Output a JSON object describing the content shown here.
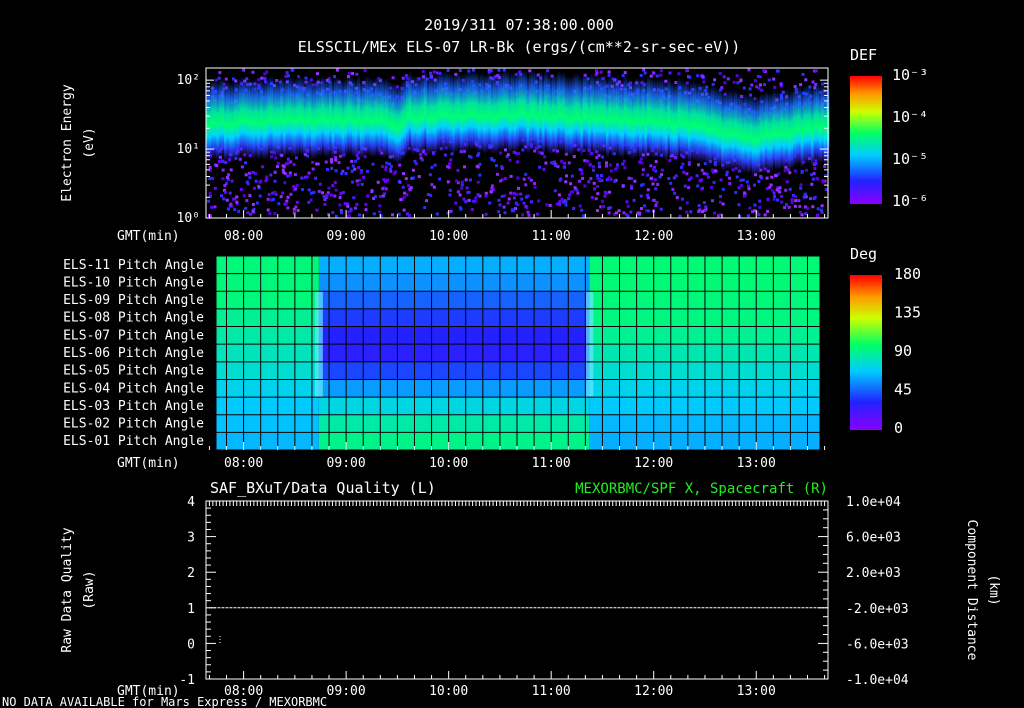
{
  "header": {
    "datetime": "2019/311 07:38:00.000",
    "title": "ELSSCIL/MEx ELS-07 LR-Bk  (ergs/(cm**2-sr-sec-eV))"
  },
  "time_axis": {
    "label": "GMT(min)",
    "ticks": [
      "08:00",
      "09:00",
      "10:00",
      "11:00",
      "12:00",
      "13:00"
    ],
    "start_min": 458,
    "end_min": 822
  },
  "footer": {
    "note": "NO DATA AVAILABLE for Mars  Express / MEXORBMC"
  },
  "colors": {
    "background": "#000000",
    "text": "#ffffff",
    "right_axis_label": "#22ee22",
    "quality_line": "#ffffff"
  },
  "chart_data": [
    {
      "type": "heatmap",
      "name": "spectrogram",
      "title": "ELSSCIL/MEx ELS-07 LR-Bk  (ergs/(cm**2-sr-sec-eV))",
      "ylabel": "Electron Energy\n(eV)",
      "ylabel_lines": [
        "Electron Energy",
        "(eV)"
      ],
      "yscale": "log",
      "ylim": [
        1,
        150
      ],
      "yticks": [
        "10⁰",
        "10¹",
        "10²"
      ],
      "colorbar": {
        "title": "DEF",
        "scale": "log",
        "range": [
          1e-06,
          0.001
        ],
        "ticks": [
          "10⁻³",
          "10⁻⁴",
          "10⁻⁵",
          "10⁻⁶"
        ]
      },
      "band_center_ev": [
        [
          458,
          22
        ],
        [
          500,
          24
        ],
        [
          560,
          25
        ],
        [
          570,
          20
        ],
        [
          575,
          28
        ],
        [
          640,
          30
        ],
        [
          700,
          25
        ],
        [
          740,
          22
        ],
        [
          760,
          16
        ],
        [
          780,
          14
        ],
        [
          800,
          17
        ],
        [
          822,
          20
        ]
      ],
      "notes": "Green/cyan emission band centered near 20-30 eV, violet noise speckle above and below"
    },
    {
      "type": "heatmap",
      "name": "pitch-angle",
      "ylabel_rows": [
        "ELS-11 Pitch Angle",
        "ELS-10 Pitch Angle",
        "ELS-09 Pitch Angle",
        "ELS-08 Pitch Angle",
        "ELS-07 Pitch Angle",
        "ELS-06 Pitch Angle",
        "ELS-05 Pitch Angle",
        "ELS-04 Pitch Angle",
        "ELS-03 Pitch Angle",
        "ELS-02 Pitch Angle",
        "ELS-01 Pitch Angle"
      ],
      "colorbar": {
        "title": "Deg",
        "range": [
          0,
          180
        ],
        "ticks": [
          "180",
          "135",
          "90",
          "45",
          "0"
        ]
      },
      "segments": [
        {
          "start_min": 458,
          "end_min": 520,
          "values_deg": [
            95,
            95,
            95,
            90,
            86,
            82,
            78,
            72,
            68,
            66,
            64
          ]
        },
        {
          "start_min": 520,
          "end_min": 683,
          "values_deg": [
            62,
            56,
            46,
            38,
            32,
            30,
            40,
            58,
            74,
            86,
            92
          ]
        },
        {
          "start_min": 683,
          "end_min": 822,
          "values_deg": [
            96,
            96,
            95,
            94,
            90,
            84,
            78,
            72,
            68,
            64,
            62
          ]
        }
      ],
      "grid": true
    },
    {
      "type": "line",
      "name": "data-quality",
      "title_left": "SAF_BXuT/Data Quality (L)",
      "title_right": "MEXORBMC/SPF X, Spacecraft (R)",
      "ylabel_left": [
        "Raw Data Quality",
        "(Raw)"
      ],
      "ylabel_right": [
        "Component Distance",
        "(km)"
      ],
      "ylim_left": [
        -1,
        4
      ],
      "yticks_left": [
        "4",
        "3",
        "2",
        "1",
        "0",
        "-1"
      ],
      "ylim_right": [
        -10000,
        10000
      ],
      "yticks_right": [
        "1.0e+04",
        "6.0e+03",
        "2.0e+03",
        "-2.0e+03",
        "-6.0e+03",
        "-1.0e+04"
      ],
      "series": [
        {
          "name": "Raw",
          "x": [
            460,
            822
          ],
          "y": [
            1,
            1
          ]
        }
      ]
    }
  ]
}
